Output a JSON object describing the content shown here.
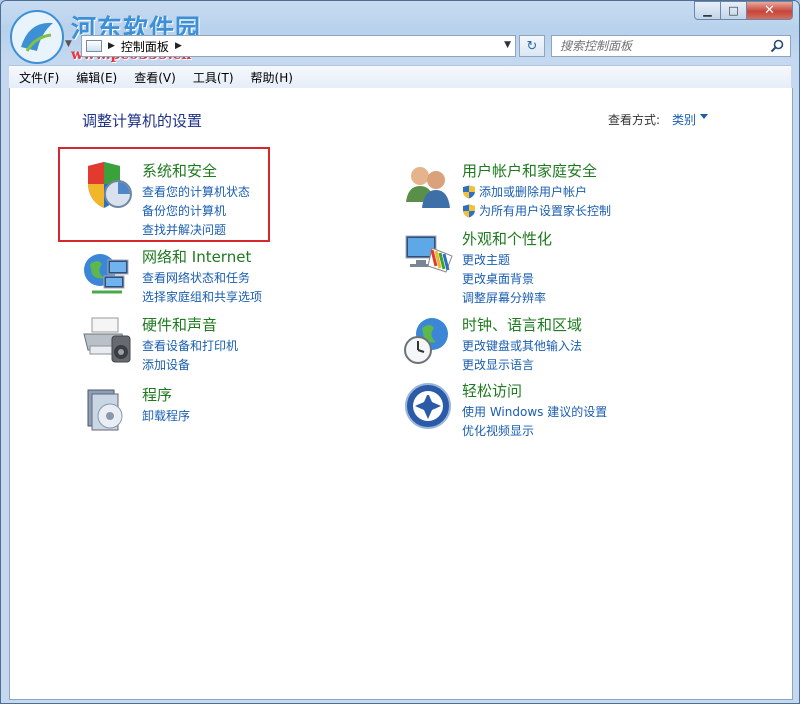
{
  "watermark": {
    "title": "河东软件园",
    "url": "www.pc0359.cn"
  },
  "window": {
    "caption": {
      "minimize": "▁",
      "maximize": "□",
      "close": "✕"
    }
  },
  "address_bar": {
    "path": [
      "控制面板"
    ],
    "refresh_label": "↻"
  },
  "search": {
    "placeholder": "搜索控制面板"
  },
  "menu": [
    {
      "label": "文件(F)"
    },
    {
      "label": "编辑(E)"
    },
    {
      "label": "查看(V)"
    },
    {
      "label": "工具(T)"
    },
    {
      "label": "帮助(H)"
    }
  ],
  "content": {
    "heading": "调整计算机的设置",
    "view_by_label": "查看方式:",
    "view_by_value": "类别"
  },
  "categories": [
    {
      "title": "系统和安全",
      "icon": "system-security-icon",
      "links": [
        {
          "text": "查看您的计算机状态",
          "shield": false
        },
        {
          "text": "备份您的计算机",
          "shield": false
        },
        {
          "text": "查找并解决问题",
          "shield": false
        }
      ]
    },
    {
      "title": "网络和 Internet",
      "icon": "network-internet-icon",
      "links": [
        {
          "text": "查看网络状态和任务",
          "shield": false
        },
        {
          "text": "选择家庭组和共享选项",
          "shield": false
        }
      ]
    },
    {
      "title": "硬件和声音",
      "icon": "hardware-sound-icon",
      "links": [
        {
          "text": "查看设备和打印机",
          "shield": false
        },
        {
          "text": "添加设备",
          "shield": false
        }
      ]
    },
    {
      "title": "程序",
      "icon": "programs-icon",
      "links": [
        {
          "text": "卸载程序",
          "shield": false
        }
      ]
    },
    {
      "title": "用户帐户和家庭安全",
      "icon": "user-accounts-icon",
      "links": [
        {
          "text": "添加或删除用户帐户",
          "shield": true
        },
        {
          "text": "为所有用户设置家长控制",
          "shield": true
        }
      ]
    },
    {
      "title": "外观和个性化",
      "icon": "appearance-icon",
      "links": [
        {
          "text": "更改主题",
          "shield": false
        },
        {
          "text": "更改桌面背景",
          "shield": false
        },
        {
          "text": "调整屏幕分辨率",
          "shield": false
        }
      ]
    },
    {
      "title": "时钟、语言和区域",
      "icon": "clock-region-icon",
      "links": [
        {
          "text": "更改键盘或其他输入法",
          "shield": false
        },
        {
          "text": "更改显示语言",
          "shield": false
        }
      ]
    },
    {
      "title": "轻松访问",
      "icon": "ease-of-access-icon",
      "links": [
        {
          "text": "使用 Windows 建议的设置",
          "shield": false
        },
        {
          "text": "优化视频显示",
          "shield": false
        }
      ]
    }
  ]
}
